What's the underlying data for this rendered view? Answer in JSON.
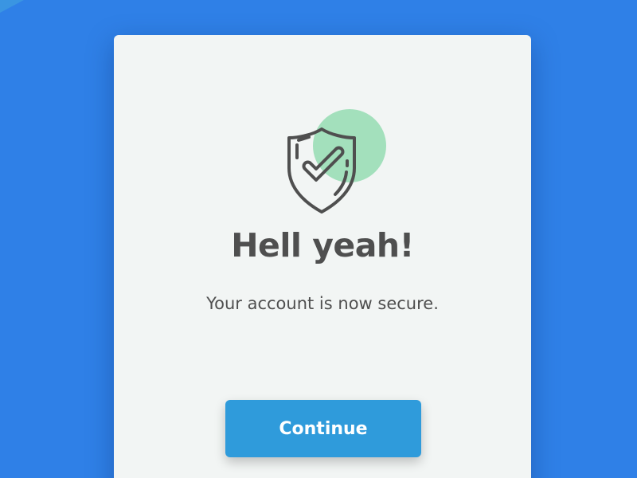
{
  "dialog": {
    "icon": "shield-check-icon",
    "title": "Hell yeah!",
    "message": "Your account is now secure.",
    "continue_label": "Continue"
  },
  "colors": {
    "background": "#2f80e7",
    "card": "#f2f5f4",
    "accent_circle": "#a3e0bc",
    "button": "#2f9bdb",
    "text": "#4f4f4f"
  }
}
